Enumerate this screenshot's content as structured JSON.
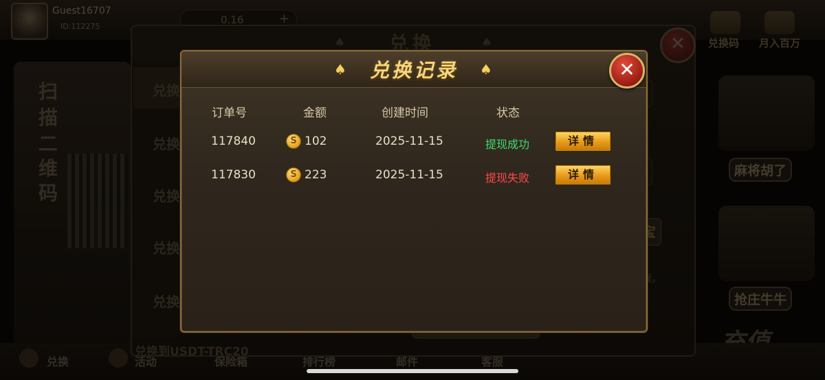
{
  "background": {
    "guest_name": "Guest16707",
    "guest_id": "ID:112275",
    "coin_value": "0.16",
    "plus": "+",
    "right_icons": [
      "兑换码",
      "月入百万"
    ],
    "promo_text": [
      "扫",
      "描",
      "二",
      "维",
      "码"
    ],
    "side_tabs": [
      "兑换",
      "兑换",
      "兑换",
      "兑换",
      "兑换"
    ],
    "panel_title": "兑换",
    "usdt_label": "兑换到USDT-TRC20",
    "bao_label": "宝",
    "wu_label": "误。",
    "bottom_nav": [
      "兑换",
      "活动",
      "保险箱",
      "排行榜",
      "邮件",
      "客服"
    ],
    "banners": [
      "麻将胡了",
      "抢庄牛牛"
    ],
    "recharge": "充值"
  },
  "modal": {
    "title": "兑换记录",
    "close_label": "✕",
    "columns": [
      "订单号",
      "金额",
      "创建时间",
      "状态"
    ],
    "rows": [
      {
        "order_id": "117840",
        "amount": "102",
        "created": "2025-11-15",
        "status": "提现成功",
        "status_type": "success",
        "detail_label": "详情"
      },
      {
        "order_id": "117830",
        "amount": "223",
        "created": "2025-11-15",
        "status": "提现失败",
        "status_type": "failure",
        "detail_label": "详情"
      }
    ],
    "coin_symbol": "S"
  },
  "colors": {
    "success": "#3ddc6e",
    "failure": "#ff4a4a",
    "title_gold": "#f6d77c"
  }
}
